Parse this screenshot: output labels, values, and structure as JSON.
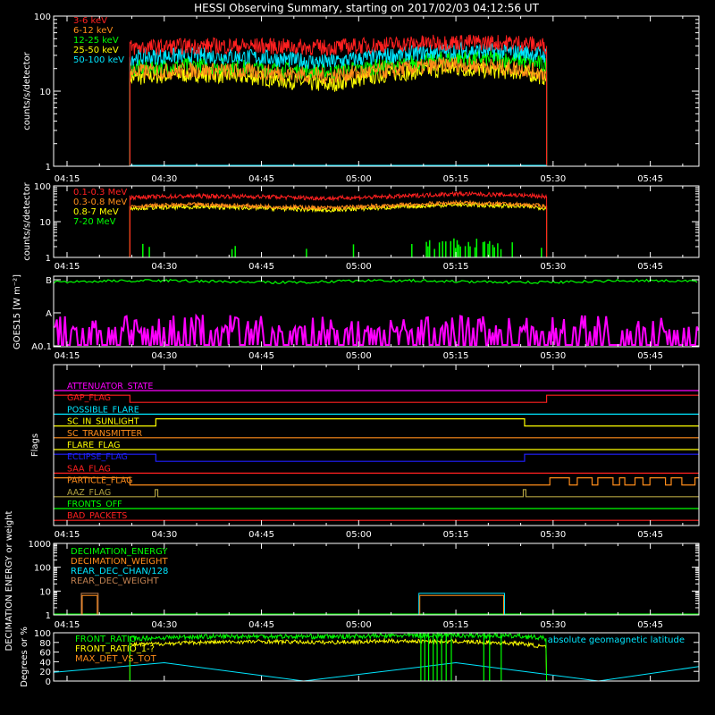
{
  "title": "HESSI Observing Summary, starting on 2017/02/03 04:12:56 UT",
  "time_ticks": [
    "04:15",
    "04:30",
    "04:45",
    "05:00",
    "05:15",
    "05:30",
    "05:45"
  ],
  "time_tick_minutes": [
    15,
    30,
    45,
    60,
    75,
    90,
    105
  ],
  "time_range_minutes": [
    12.93,
    112.5
  ],
  "observing_window_minutes": [
    24.7,
    89.0
  ],
  "colors": {
    "red": "#ff2020",
    "orange": "#ff8c1a",
    "yellow": "#ffff00",
    "green": "#00ff00",
    "cyan": "#00e6ff",
    "magenta": "#ff00ff",
    "blue": "#2020ff",
    "olive": "#b0a040",
    "brown": "#c08050"
  },
  "chart_data": [
    {
      "type": "line",
      "panel": "low_energy_rates",
      "ylabel": "counts/s/detector",
      "yscale": "log",
      "ylim": [
        1,
        100
      ],
      "ytick_labels": [
        "1",
        "10",
        "100"
      ],
      "ytick_values": [
        1,
        10,
        100
      ],
      "series": [
        {
          "name": "3-6 keV",
          "color": "#ff2020",
          "x": [
            24.7,
            35,
            45,
            55,
            65,
            75,
            85,
            89
          ],
          "y": [
            38,
            40,
            40,
            38,
            42,
            45,
            44,
            40
          ]
        },
        {
          "name": "6-12 keV",
          "color": "#ff8c1a",
          "x": [
            24.7,
            35,
            45,
            55,
            65,
            75,
            85,
            89
          ],
          "y": [
            18,
            19,
            18,
            16,
            19,
            23,
            20,
            17
          ]
        },
        {
          "name": "12-25 keV",
          "color": "#00ff00",
          "x": [
            24.7,
            35,
            45,
            55,
            65,
            75,
            85,
            89
          ],
          "y": [
            20,
            22,
            20,
            18,
            22,
            28,
            26,
            22
          ]
        },
        {
          "name": "25-50 keV",
          "color": "#ffff00",
          "x": [
            24.7,
            35,
            45,
            55,
            65,
            75,
            85,
            89
          ],
          "y": [
            15,
            17,
            15,
            12,
            17,
            20,
            18,
            15
          ]
        },
        {
          "name": "50-100 keV",
          "color": "#00e6ff",
          "x": [
            24.7,
            35,
            45,
            55,
            65,
            75,
            85,
            89
          ],
          "y": [
            28,
            30,
            28,
            24,
            30,
            35,
            33,
            30
          ]
        }
      ]
    },
    {
      "type": "line",
      "panel": "high_energy_rates",
      "ylabel": "counts/s/detector",
      "yscale": "log",
      "ylim": [
        1,
        100
      ],
      "ytick_labels": [
        "1",
        "10",
        "100"
      ],
      "ytick_values": [
        1,
        10,
        100
      ],
      "series": [
        {
          "name": "0.1-0.3 MeV",
          "color": "#ff2020",
          "x": [
            24.7,
            35,
            45,
            55,
            65,
            75,
            85,
            89
          ],
          "y": [
            48,
            52,
            50,
            45,
            50,
            60,
            55,
            50
          ]
        },
        {
          "name": "0.3-0.8 MeV",
          "color": "#ff8c1a",
          "x": [
            24.7,
            35,
            45,
            55,
            65,
            75,
            85,
            89
          ],
          "y": [
            27,
            30,
            27,
            24,
            28,
            34,
            30,
            27
          ]
        },
        {
          "name": "0.8-7 MeV",
          "color": "#ffff00",
          "x": [
            24.7,
            35,
            45,
            55,
            65,
            75,
            85,
            89
          ],
          "y": [
            24,
            26,
            24,
            21,
            25,
            30,
            27,
            24
          ]
        },
        {
          "name": "7-20 MeV",
          "color": "#00ff00",
          "x": [
            24.7,
            89
          ],
          "y": [
            1,
            1
          ]
        }
      ]
    },
    {
      "type": "line",
      "panel": "goes15",
      "ylabel": "GOES15 [W m⁻²]",
      "ytick_labels": [
        "A0.1",
        "A",
        "B"
      ],
      "series": [
        {
          "color": "#00ff00",
          "level": "B"
        },
        {
          "color": "#ff00ff",
          "level": "A0.1"
        }
      ]
    },
    {
      "type": "step",
      "panel": "flags",
      "ylabel": "Flags",
      "flags": [
        {
          "name": "ATTENUATOR_STATE",
          "color": "#ff00ff",
          "changes": []
        },
        {
          "name": "GAP_FLAG",
          "color": "#ff2020",
          "changes": [
            [
              12.93,
              1
            ],
            [
              24.7,
              0
            ],
            [
              89,
              1
            ]
          ]
        },
        {
          "name": "POSSIBLE_FLARE",
          "color": "#00e6ff",
          "changes": []
        },
        {
          "name": "SC_IN_SUNLIGHT",
          "color": "#ffff00",
          "changes": [
            [
              12.93,
              0
            ],
            [
              28.7,
              1
            ],
            [
              85.6,
              0
            ]
          ]
        },
        {
          "name": "SC_TRANSMITTER",
          "color": "#ff8c1a",
          "changes": []
        },
        {
          "name": "FLARE_FLAG",
          "color": "#ffff00",
          "changes": []
        },
        {
          "name": "ECLIPSE_FLAG",
          "color": "#2020ff",
          "changes": [
            [
              12.93,
              1
            ],
            [
              28.7,
              0
            ],
            [
              85.6,
              1
            ]
          ]
        },
        {
          "name": "SAA_FLAG",
          "color": "#ff2020",
          "changes": []
        },
        {
          "name": "PARTICLE_FLAG",
          "color": "#ff8c1a",
          "changes": [
            [
              12.93,
              1
            ]
          ]
        },
        {
          "name": "AAZ_FLAG",
          "color": "#b0a040",
          "changes": []
        },
        {
          "name": "FRONTS_OFF",
          "color": "#00ff00",
          "changes": []
        },
        {
          "name": "BAD_PACKETS",
          "color": "#ff2020",
          "changes": []
        }
      ]
    },
    {
      "type": "step",
      "panel": "decimation",
      "ylabel": "DECIMATION ENERGY or weight",
      "yscale": "log",
      "ylim": [
        1,
        1000
      ],
      "ytick_labels": [
        "1",
        "10",
        "100",
        "1000"
      ],
      "ytick_values": [
        1,
        10,
        100,
        1000
      ],
      "series": [
        {
          "name": "DECIMATION_ENERGY",
          "color": "#00ff00"
        },
        {
          "name": "DECIMATION_WEIGHT",
          "color": "#ff8c1a"
        },
        {
          "name": "REAR_DEC_CHAN/128",
          "color": "#00e6ff",
          "x": [
            69.3,
            69.3,
            82.5,
            82.5
          ],
          "y": [
            1,
            8,
            8,
            1
          ]
        },
        {
          "name": "REAR_DEC_WEIGHT",
          "color": "#c08050",
          "x": [
            17.2,
            17.2,
            19.8,
            19.8
          ],
          "y": [
            1,
            8,
            8,
            1
          ]
        }
      ]
    },
    {
      "type": "line",
      "panel": "ratios",
      "ylabel": "Degrees or %",
      "ylim": [
        0,
        100
      ],
      "ytick_labels": [
        "0",
        "20",
        "40",
        "60",
        "80",
        "100"
      ],
      "ytick_values": [
        0,
        20,
        40,
        60,
        80,
        100
      ],
      "annotation": "absolute geomagnetic latitude",
      "series": [
        {
          "name": "FRONT_RATIO",
          "color": "#00ff00",
          "x": [
            24.7,
            35,
            45,
            55,
            65,
            75,
            85,
            89
          ],
          "y": [
            88,
            92,
            93,
            92,
            94,
            95,
            93,
            88
          ]
        },
        {
          "name": "FRONT_RATIO_1-?",
          "color": "#ffff00",
          "x": [
            24.7,
            35,
            45,
            55,
            65,
            75,
            85,
            89
          ],
          "y": [
            75,
            80,
            82,
            80,
            83,
            82,
            78,
            70
          ]
        },
        {
          "name": "MAX_DET_VS_TOT",
          "color": "#ff8c1a"
        },
        {
          "name": "absolute geomagnetic latitude",
          "color": "#00e6ff",
          "x": [
            12.93,
            30,
            51.5,
            75,
            97,
            112.5
          ],
          "y": [
            18,
            38,
            0,
            38,
            0,
            30
          ]
        }
      ]
    }
  ]
}
